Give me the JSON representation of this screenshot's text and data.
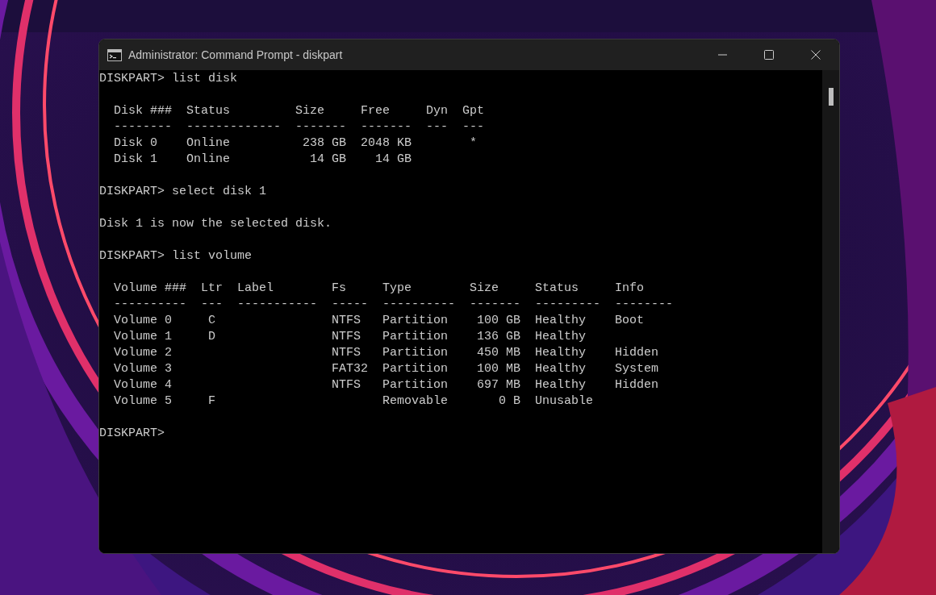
{
  "window": {
    "title": "Administrator: Command Prompt - diskpart"
  },
  "console": {
    "lines": [
      {
        "kind": "line",
        "text": "DISKPART> list disk"
      },
      {
        "kind": "blank"
      },
      {
        "kind": "line",
        "text": "  Disk ###  Status         Size     Free     Dyn  Gpt"
      },
      {
        "kind": "line",
        "text": "  --------  -------------  -------  -------  ---  ---"
      },
      {
        "kind": "line",
        "text": "  Disk 0    Online          238 GB  2048 KB        *"
      },
      {
        "kind": "line",
        "text": "  Disk 1    Online           14 GB    14 GB"
      },
      {
        "kind": "blank"
      },
      {
        "kind": "line",
        "text": "DISKPART> select disk 1"
      },
      {
        "kind": "blank"
      },
      {
        "kind": "line",
        "text": "Disk 1 is now the selected disk."
      },
      {
        "kind": "blank"
      },
      {
        "kind": "line",
        "text": "DISKPART> list volume"
      },
      {
        "kind": "blank"
      },
      {
        "kind": "line",
        "text": "  Volume ###  Ltr  Label        Fs     Type        Size     Status     Info"
      },
      {
        "kind": "line",
        "text": "  ----------  ---  -----------  -----  ----------  -------  ---------  --------"
      },
      {
        "kind": "line",
        "text": "  Volume 0     C                NTFS   Partition    100 GB  Healthy    Boot"
      },
      {
        "kind": "line",
        "text": "  Volume 1     D                NTFS   Partition    136 GB  Healthy"
      },
      {
        "kind": "line",
        "text": "  Volume 2                      NTFS   Partition    450 MB  Healthy    Hidden"
      },
      {
        "kind": "line",
        "text": "  Volume 3                      FAT32  Partition    100 MB  Healthy    System"
      },
      {
        "kind": "line",
        "text": "  Volume 4                      NTFS   Partition    697 MB  Healthy    Hidden"
      },
      {
        "kind": "line",
        "text": "  Volume 5     F                       Removable       0 B  Unusable"
      },
      {
        "kind": "blank"
      },
      {
        "kind": "line",
        "text": "DISKPART>"
      }
    ]
  }
}
